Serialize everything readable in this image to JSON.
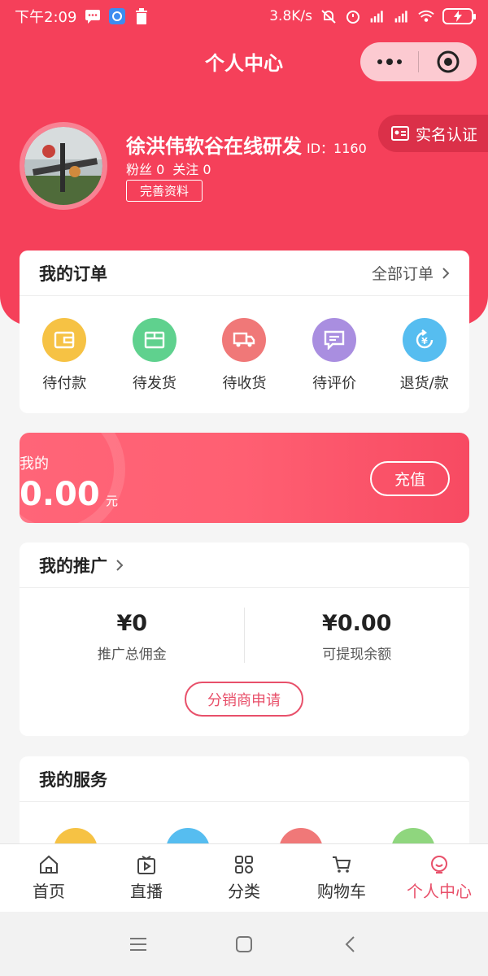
{
  "status_bar": {
    "time": "下午2:09",
    "speed": "3.8K/s"
  },
  "nav": {
    "title": "个人中心"
  },
  "profile": {
    "name": "徐洪伟软谷在线研发",
    "id": "ID：1160",
    "fans": "粉丝 0",
    "following": "关注 0",
    "edit_label": "完善资料",
    "realname_label": "实名认证"
  },
  "orders": {
    "title": "我的订单",
    "more": "全部订单",
    "items": [
      {
        "label": "待付款",
        "icon": "wallet-icon",
        "color": "#f6c244"
      },
      {
        "label": "待发货",
        "icon": "box-icon",
        "color": "#5fd18e"
      },
      {
        "label": "待收货",
        "icon": "truck-icon",
        "color": "#f07878"
      },
      {
        "label": "待评价",
        "icon": "comment-icon",
        "color": "#a98ee0"
      },
      {
        "label": "退货/款",
        "icon": "refund-icon",
        "color": "#56bdf0"
      }
    ]
  },
  "wallet": {
    "label": "我的",
    "amount": "0.00",
    "unit": "元",
    "recharge_label": "充值"
  },
  "promotion": {
    "title": "我的推广",
    "total_commission_value": "¥0",
    "total_commission_label": "推广总佣金",
    "withdrawable_value": "¥0.00",
    "withdrawable_label": "可提现余额",
    "apply_label": "分销商申请"
  },
  "services": {
    "title": "我的服务",
    "icon_colors": [
      "#f6c244",
      "#56bdf0",
      "#f07878",
      "#8fd67e"
    ]
  },
  "tabbar": {
    "items": [
      {
        "label": "首页",
        "icon": "home-icon"
      },
      {
        "label": "直播",
        "icon": "live-icon"
      },
      {
        "label": "分类",
        "icon": "category-icon"
      },
      {
        "label": "购物车",
        "icon": "cart-icon"
      },
      {
        "label": "个人中心",
        "icon": "profile-icon",
        "active": true
      }
    ]
  },
  "colors": {
    "primary": "#f5405a",
    "accent": "#e8506a"
  }
}
